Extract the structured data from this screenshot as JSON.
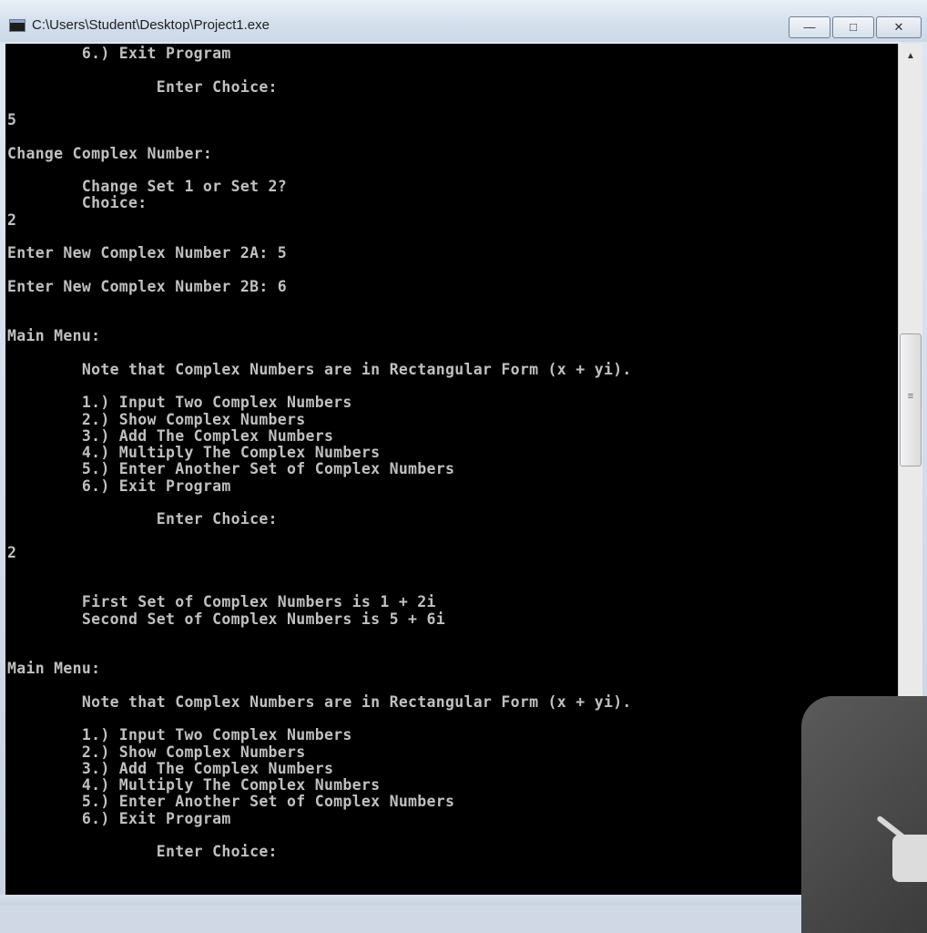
{
  "window": {
    "title": "C:\\Users\\Student\\Desktop\\Project1.exe",
    "controls": {
      "minimize": "—",
      "maximize": "□",
      "close": "✕"
    }
  },
  "console": {
    "text": "        6.) Exit Program\n\n                Enter Choice:\n\n5\n\nChange Complex Number:\n\n        Change Set 1 or Set 2?\n        Choice:\n2\n\nEnter New Complex Number 2A: 5\n\nEnter New Complex Number 2B: 6\n\n\nMain Menu:\n\n        Note that Complex Numbers are in Rectangular Form (x + yi).\n\n        1.) Input Two Complex Numbers\n        2.) Show Complex Numbers\n        3.) Add The Complex Numbers\n        4.) Multiply The Complex Numbers\n        5.) Enter Another Set of Complex Numbers\n        6.) Exit Program\n\n                Enter Choice:\n\n2\n\n\n        First Set of Complex Numbers is 1 + 2i\n        Second Set of Complex Numbers is 5 + 6i\n\n\nMain Menu:\n\n        Note that Complex Numbers are in Rectangular Form (x + yi).\n\n        1.) Input Two Complex Numbers\n        2.) Show Complex Numbers\n        3.) Add The Complex Numbers\n        4.) Multiply The Complex Numbers\n        5.) Enter Another Set of Complex Numbers\n        6.) Exit Program\n\n                Enter Choice:"
  },
  "scrollbar": {
    "up_arrow": "▲",
    "grip": "≡",
    "position_fraction": 0.36
  },
  "colors": {
    "console_bg": "#000000",
    "console_fg": "#c0c0c0",
    "titlebar": "#d6e1ee"
  }
}
